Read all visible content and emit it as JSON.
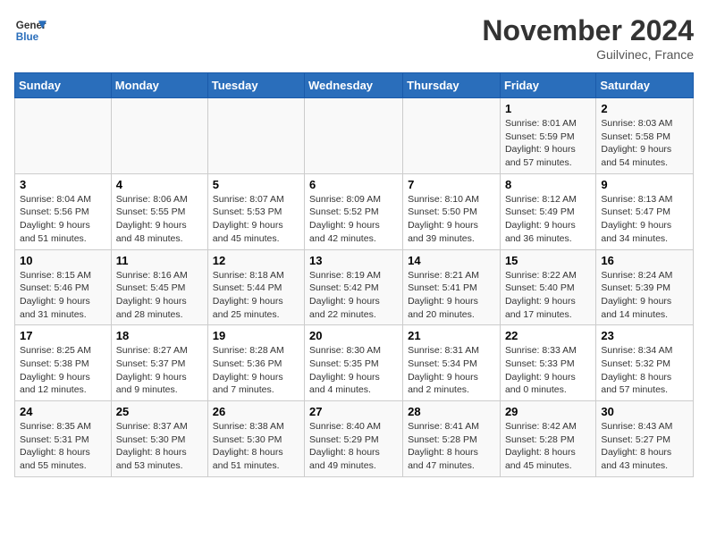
{
  "header": {
    "logo_line1": "General",
    "logo_line2": "Blue",
    "month": "November 2024",
    "location": "Guilvinec, France"
  },
  "weekdays": [
    "Sunday",
    "Monday",
    "Tuesday",
    "Wednesday",
    "Thursday",
    "Friday",
    "Saturday"
  ],
  "weeks": [
    [
      {
        "day": "",
        "info": ""
      },
      {
        "day": "",
        "info": ""
      },
      {
        "day": "",
        "info": ""
      },
      {
        "day": "",
        "info": ""
      },
      {
        "day": "",
        "info": ""
      },
      {
        "day": "1",
        "info": "Sunrise: 8:01 AM\nSunset: 5:59 PM\nDaylight: 9 hours and 57 minutes."
      },
      {
        "day": "2",
        "info": "Sunrise: 8:03 AM\nSunset: 5:58 PM\nDaylight: 9 hours and 54 minutes."
      }
    ],
    [
      {
        "day": "3",
        "info": "Sunrise: 8:04 AM\nSunset: 5:56 PM\nDaylight: 9 hours and 51 minutes."
      },
      {
        "day": "4",
        "info": "Sunrise: 8:06 AM\nSunset: 5:55 PM\nDaylight: 9 hours and 48 minutes."
      },
      {
        "day": "5",
        "info": "Sunrise: 8:07 AM\nSunset: 5:53 PM\nDaylight: 9 hours and 45 minutes."
      },
      {
        "day": "6",
        "info": "Sunrise: 8:09 AM\nSunset: 5:52 PM\nDaylight: 9 hours and 42 minutes."
      },
      {
        "day": "7",
        "info": "Sunrise: 8:10 AM\nSunset: 5:50 PM\nDaylight: 9 hours and 39 minutes."
      },
      {
        "day": "8",
        "info": "Sunrise: 8:12 AM\nSunset: 5:49 PM\nDaylight: 9 hours and 36 minutes."
      },
      {
        "day": "9",
        "info": "Sunrise: 8:13 AM\nSunset: 5:47 PM\nDaylight: 9 hours and 34 minutes."
      }
    ],
    [
      {
        "day": "10",
        "info": "Sunrise: 8:15 AM\nSunset: 5:46 PM\nDaylight: 9 hours and 31 minutes."
      },
      {
        "day": "11",
        "info": "Sunrise: 8:16 AM\nSunset: 5:45 PM\nDaylight: 9 hours and 28 minutes."
      },
      {
        "day": "12",
        "info": "Sunrise: 8:18 AM\nSunset: 5:44 PM\nDaylight: 9 hours and 25 minutes."
      },
      {
        "day": "13",
        "info": "Sunrise: 8:19 AM\nSunset: 5:42 PM\nDaylight: 9 hours and 22 minutes."
      },
      {
        "day": "14",
        "info": "Sunrise: 8:21 AM\nSunset: 5:41 PM\nDaylight: 9 hours and 20 minutes."
      },
      {
        "day": "15",
        "info": "Sunrise: 8:22 AM\nSunset: 5:40 PM\nDaylight: 9 hours and 17 minutes."
      },
      {
        "day": "16",
        "info": "Sunrise: 8:24 AM\nSunset: 5:39 PM\nDaylight: 9 hours and 14 minutes."
      }
    ],
    [
      {
        "day": "17",
        "info": "Sunrise: 8:25 AM\nSunset: 5:38 PM\nDaylight: 9 hours and 12 minutes."
      },
      {
        "day": "18",
        "info": "Sunrise: 8:27 AM\nSunset: 5:37 PM\nDaylight: 9 hours and 9 minutes."
      },
      {
        "day": "19",
        "info": "Sunrise: 8:28 AM\nSunset: 5:36 PM\nDaylight: 9 hours and 7 minutes."
      },
      {
        "day": "20",
        "info": "Sunrise: 8:30 AM\nSunset: 5:35 PM\nDaylight: 9 hours and 4 minutes."
      },
      {
        "day": "21",
        "info": "Sunrise: 8:31 AM\nSunset: 5:34 PM\nDaylight: 9 hours and 2 minutes."
      },
      {
        "day": "22",
        "info": "Sunrise: 8:33 AM\nSunset: 5:33 PM\nDaylight: 9 hours and 0 minutes."
      },
      {
        "day": "23",
        "info": "Sunrise: 8:34 AM\nSunset: 5:32 PM\nDaylight: 8 hours and 57 minutes."
      }
    ],
    [
      {
        "day": "24",
        "info": "Sunrise: 8:35 AM\nSunset: 5:31 PM\nDaylight: 8 hours and 55 minutes."
      },
      {
        "day": "25",
        "info": "Sunrise: 8:37 AM\nSunset: 5:30 PM\nDaylight: 8 hours and 53 minutes."
      },
      {
        "day": "26",
        "info": "Sunrise: 8:38 AM\nSunset: 5:30 PM\nDaylight: 8 hours and 51 minutes."
      },
      {
        "day": "27",
        "info": "Sunrise: 8:40 AM\nSunset: 5:29 PM\nDaylight: 8 hours and 49 minutes."
      },
      {
        "day": "28",
        "info": "Sunrise: 8:41 AM\nSunset: 5:28 PM\nDaylight: 8 hours and 47 minutes."
      },
      {
        "day": "29",
        "info": "Sunrise: 8:42 AM\nSunset: 5:28 PM\nDaylight: 8 hours and 45 minutes."
      },
      {
        "day": "30",
        "info": "Sunrise: 8:43 AM\nSunset: 5:27 PM\nDaylight: 8 hours and 43 minutes."
      }
    ]
  ]
}
